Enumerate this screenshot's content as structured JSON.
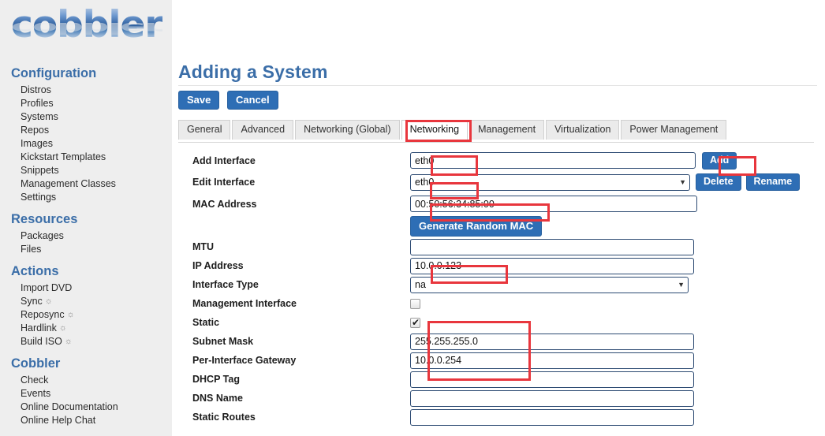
{
  "brand": {
    "logo_text": "cobbler"
  },
  "sidebar": {
    "sections": [
      {
        "heading": "Configuration",
        "items": [
          "Distros",
          "Profiles",
          "Systems",
          "Repos",
          "Images",
          "Kickstart Templates",
          "Snippets",
          "Management Classes",
          "Settings"
        ]
      },
      {
        "heading": "Resources",
        "items": [
          "Packages",
          "Files"
        ]
      },
      {
        "heading": "Actions",
        "items": [
          "Import DVD",
          "Sync",
          "Reposync",
          "Hardlink",
          "Build ISO"
        ]
      },
      {
        "heading": "Cobbler",
        "items": [
          "Check",
          "Events",
          "Online Documentation",
          "Online Help Chat"
        ]
      }
    ]
  },
  "page": {
    "title": "Adding a System",
    "save_label": "Save",
    "cancel_label": "Cancel"
  },
  "tabs": [
    {
      "label": "General",
      "active": false
    },
    {
      "label": "Advanced",
      "active": false
    },
    {
      "label": "Networking (Global)",
      "active": false
    },
    {
      "label": "Networking",
      "active": true
    },
    {
      "label": "Management",
      "active": false
    },
    {
      "label": "Virtualization",
      "active": false
    },
    {
      "label": "Power Management",
      "active": false
    }
  ],
  "form": {
    "add_interface": {
      "label": "Add Interface",
      "value": "eth0",
      "button": "Add"
    },
    "edit_interface": {
      "label": "Edit Interface",
      "value": "eth0",
      "delete_button": "Delete",
      "rename_button": "Rename"
    },
    "mac_address": {
      "label": "MAC Address",
      "value": "00:50:56:34:85:00"
    },
    "generate_mac_button": "Generate Random MAC",
    "mtu": {
      "label": "MTU",
      "value": ""
    },
    "ip_address": {
      "label": "IP Address",
      "value": "10.0.0.123"
    },
    "interface_type": {
      "label": "Interface Type",
      "value": "na"
    },
    "management_interface": {
      "label": "Management Interface",
      "checked": false
    },
    "static": {
      "label": "Static",
      "checked": true
    },
    "subnet_mask": {
      "label": "Subnet Mask",
      "value": "255.255.255.0"
    },
    "gateway": {
      "label": "Per-Interface Gateway",
      "value": "10.0.0.254"
    },
    "dhcp_tag": {
      "label": "DHCP Tag",
      "value": ""
    },
    "dns_name": {
      "label": "DNS Name",
      "value": ""
    },
    "static_routes": {
      "label": "Static Routes",
      "value": ""
    }
  },
  "colors": {
    "accent_blue": "#2e6eb5",
    "heading_blue": "#3b6ea8",
    "highlight_red": "#e8363d",
    "sidebar_bg": "#eeeeee"
  }
}
